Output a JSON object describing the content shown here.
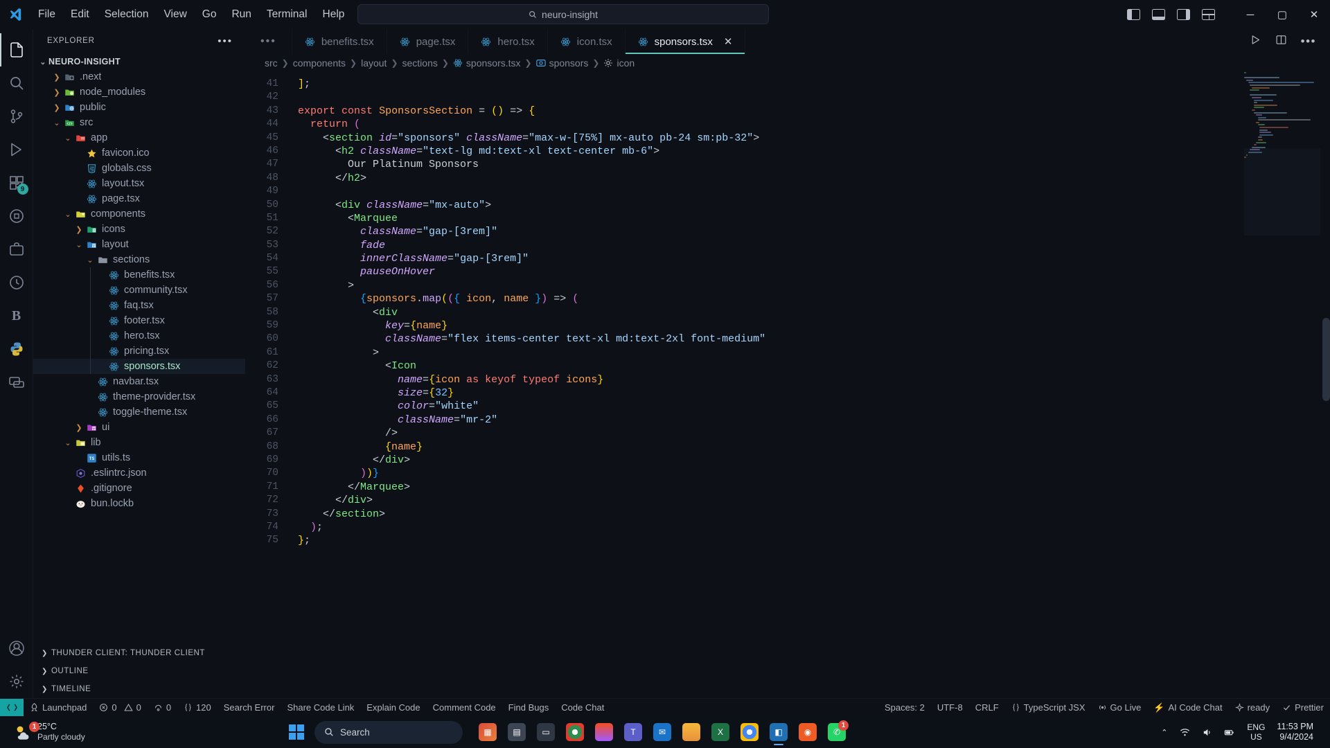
{
  "titlebar": {
    "menus": [
      "File",
      "Edit",
      "Selection",
      "View",
      "Go",
      "Run",
      "Terminal",
      "Help"
    ],
    "search_value": "neuro-insight",
    "back_arrow": "←",
    "forward_arrow": "→",
    "minimize": "─",
    "maximize": "▢",
    "close": "✕"
  },
  "activitybar": {
    "items": [
      {
        "name": "explorer",
        "badge": ""
      },
      {
        "name": "search",
        "badge": ""
      },
      {
        "name": "source-control",
        "badge": ""
      },
      {
        "name": "run-and-debug",
        "badge": ""
      },
      {
        "name": "extensions",
        "badge": "9"
      },
      {
        "name": "testing",
        "badge": ""
      },
      {
        "name": "remote-explorer",
        "badge": ""
      },
      {
        "name": "error-lens",
        "badge": ""
      },
      {
        "name": "better-comments",
        "badge": "B"
      },
      {
        "name": "python",
        "badge": ""
      },
      {
        "name": "live-share",
        "badge": ""
      },
      {
        "name": "accounts",
        "badge": ""
      },
      {
        "name": "manage-settings",
        "badge": ""
      }
    ],
    "letter_b": "B"
  },
  "sidebar": {
    "title": "EXPLORER",
    "more_actions": "•••",
    "root": "NEURO-INSIGHT",
    "tree": [
      {
        "label": ".next",
        "depth": 1,
        "type": "folder",
        "state": "collapsed",
        "icon": "folder-next"
      },
      {
        "label": "node_modules",
        "depth": 1,
        "type": "folder",
        "state": "collapsed",
        "icon": "folder-node"
      },
      {
        "label": "public",
        "depth": 1,
        "type": "folder",
        "state": "collapsed",
        "icon": "folder-public"
      },
      {
        "label": "src",
        "depth": 1,
        "type": "folder",
        "state": "expanded",
        "icon": "folder-src"
      },
      {
        "label": "app",
        "depth": 2,
        "type": "folder",
        "state": "expanded",
        "icon": "folder-app"
      },
      {
        "label": "favicon.ico",
        "depth": 3,
        "type": "file",
        "icon": "star-icon"
      },
      {
        "label": "globals.css",
        "depth": 3,
        "type": "file",
        "icon": "css-icon"
      },
      {
        "label": "layout.tsx",
        "depth": 3,
        "type": "file",
        "icon": "react-icon"
      },
      {
        "label": "page.tsx",
        "depth": 3,
        "type": "file",
        "icon": "react-icon"
      },
      {
        "label": "components",
        "depth": 2,
        "type": "folder",
        "state": "expanded",
        "icon": "folder-components"
      },
      {
        "label": "icons",
        "depth": 3,
        "type": "folder",
        "state": "collapsed",
        "icon": "folder-icons"
      },
      {
        "label": "layout",
        "depth": 3,
        "type": "folder",
        "state": "expanded",
        "icon": "folder-layout"
      },
      {
        "label": "sections",
        "depth": 4,
        "type": "folder",
        "state": "expanded",
        "icon": "folder-plain"
      },
      {
        "label": "benefits.tsx",
        "depth": 5,
        "type": "file",
        "icon": "react-icon"
      },
      {
        "label": "community.tsx",
        "depth": 5,
        "type": "file",
        "icon": "react-icon"
      },
      {
        "label": "faq.tsx",
        "depth": 5,
        "type": "file",
        "icon": "react-icon"
      },
      {
        "label": "footer.tsx",
        "depth": 5,
        "type": "file",
        "icon": "react-icon"
      },
      {
        "label": "hero.tsx",
        "depth": 5,
        "type": "file",
        "icon": "react-icon"
      },
      {
        "label": "pricing.tsx",
        "depth": 5,
        "type": "file",
        "icon": "react-icon"
      },
      {
        "label": "sponsors.tsx",
        "depth": 5,
        "type": "file",
        "icon": "react-icon",
        "selected": true
      },
      {
        "label": "navbar.tsx",
        "depth": 4,
        "type": "file",
        "icon": "react-icon"
      },
      {
        "label": "theme-provider.tsx",
        "depth": 4,
        "type": "file",
        "icon": "react-icon"
      },
      {
        "label": "toggle-theme.tsx",
        "depth": 4,
        "type": "file",
        "icon": "react-icon"
      },
      {
        "label": "ui",
        "depth": 3,
        "type": "folder",
        "state": "collapsed",
        "icon": "folder-ui"
      },
      {
        "label": "lib",
        "depth": 2,
        "type": "folder",
        "state": "expanded",
        "icon": "folder-lib"
      },
      {
        "label": "utils.ts",
        "depth": 3,
        "type": "file",
        "icon": "ts-icon"
      },
      {
        "label": ".eslintrc.json",
        "depth": 2,
        "type": "file",
        "icon": "eslint-icon"
      },
      {
        "label": ".gitignore",
        "depth": 2,
        "type": "file",
        "icon": "git-icon"
      },
      {
        "label": "bun.lockb",
        "depth": 2,
        "type": "file",
        "icon": "bun-icon"
      }
    ],
    "sections": [
      "THUNDER CLIENT: THUNDER CLIENT",
      "OUTLINE",
      "TIMELINE"
    ]
  },
  "tabs": [
    {
      "label": "benefits.tsx",
      "active": false,
      "icon": "react-icon"
    },
    {
      "label": "page.tsx",
      "active": false,
      "icon": "react-icon"
    },
    {
      "label": "hero.tsx",
      "active": false,
      "icon": "react-icon"
    },
    {
      "label": "icon.tsx",
      "active": false,
      "icon": "react-icon"
    },
    {
      "label": "sponsors.tsx",
      "active": true,
      "icon": "react-icon",
      "close": "✕"
    }
  ],
  "tab_overflow": "•••",
  "breadcrumb": [
    {
      "label": "src",
      "icon": ""
    },
    {
      "label": "components",
      "icon": ""
    },
    {
      "label": "layout",
      "icon": ""
    },
    {
      "label": "sections",
      "icon": ""
    },
    {
      "label": "sponsors.tsx",
      "icon": "react-icon"
    },
    {
      "label": "sponsors",
      "icon": "symbol-variable"
    },
    {
      "label": "icon",
      "icon": "symbol-property"
    }
  ],
  "editor": {
    "first_line": 41,
    "last_line": 75,
    "lines": [
      {
        "n": 41,
        "html": "<span class='br1'>]</span><span class='pun'>;</span>"
      },
      {
        "n": 42,
        "html": ""
      },
      {
        "n": 43,
        "html": "<span class='kw'>export</span> <span class='kw'>const</span> <span class='var'>SponsorsSection</span> <span class='pun'>=</span> <span class='br1'>(</span><span class='br1'>)</span> <span class='pun'>=&gt;</span> <span class='br1'>{</span>"
      },
      {
        "n": 44,
        "html": "  <span class='kw'>return</span> <span class='br2'>(</span>"
      },
      {
        "n": 45,
        "html": "    <span class='pun'>&lt;</span><span class='tag'>section</span> <span class='attr'>id</span><span class='pun'>=</span><span class='str'>\"sponsors\"</span> <span class='attr'>className</span><span class='pun'>=</span><span class='str'>\"max-w-[75%] mx-auto pb-24 sm:pb-32\"</span><span class='pun'>&gt;</span>"
      },
      {
        "n": 46,
        "html": "      <span class='pun'>&lt;</span><span class='tag'>h2</span> <span class='attr'>className</span><span class='pun'>=</span><span class='str'>\"text-lg md:text-xl text-center mb-6\"</span><span class='pun'>&gt;</span>"
      },
      {
        "n": 47,
        "html": "        <span class='pun'>Our Platinum Sponsors</span>"
      },
      {
        "n": 48,
        "html": "      <span class='pun'>&lt;/</span><span class='tag'>h2</span><span class='pun'>&gt;</span>"
      },
      {
        "n": 49,
        "html": ""
      },
      {
        "n": 50,
        "html": "      <span class='pun'>&lt;</span><span class='tag'>div</span> <span class='attr'>className</span><span class='pun'>=</span><span class='str'>\"mx-auto\"</span><span class='pun'>&gt;</span>"
      },
      {
        "n": 51,
        "html": "        <span class='pun'>&lt;</span><span class='tag'>Marquee</span>"
      },
      {
        "n": 52,
        "html": "          <span class='attr'>className</span><span class='pun'>=</span><span class='str'>\"gap-[3rem]\"</span>"
      },
      {
        "n": 53,
        "html": "          <span class='attr'>fade</span>"
      },
      {
        "n": 54,
        "html": "          <span class='attr'>innerClassName</span><span class='pun'>=</span><span class='str'>\"gap-[3rem]\"</span>"
      },
      {
        "n": 55,
        "html": "          <span class='attr'>pauseOnHover</span>"
      },
      {
        "n": 56,
        "html": "        <span class='pun'>&gt;</span>"
      },
      {
        "n": 57,
        "html": "          <span class='br3'>{</span><span class='var'>sponsors</span><span class='pun'>.</span><span class='fn'>map</span><span class='br1'>(</span><span class='br2'>(</span><span class='br3'>{</span> <span class='var'>icon</span><span class='pun'>,</span> <span class='var'>name</span> <span class='br3'>}</span><span class='br2'>)</span> <span class='pun'>=&gt;</span> <span class='br2'>(</span>"
      },
      {
        "n": 58,
        "html": "            <span class='pun'>&lt;</span><span class='tag'>div</span>"
      },
      {
        "n": 59,
        "html": "              <span class='attr'>key</span><span class='pun'>=</span><span class='br1'>{</span><span class='var'>name</span><span class='br1'>}</span>"
      },
      {
        "n": 60,
        "html": "              <span class='attr'>className</span><span class='pun'>=</span><span class='str'>\"flex items-center text-xl md:text-2xl font-medium\"</span>"
      },
      {
        "n": 61,
        "html": "            <span class='pun'>&gt;</span>"
      },
      {
        "n": 62,
        "html": "              <span class='pun'>&lt;</span><span class='tag'>Icon</span>"
      },
      {
        "n": 63,
        "html": "                <span class='attr'>name</span><span class='pun'>=</span><span class='br1'>{</span><span class='var'>icon</span> <span class='kw'>as</span> <span class='kw'>keyof</span> <span class='kw'>typeof</span> <span class='var'>icons</span><span class='br1'>}</span>"
      },
      {
        "n": 64,
        "html": "                <span class='attr'>size</span><span class='pun'>=</span><span class='br1'>{</span><span class='num'>32</span><span class='br1'>}</span>"
      },
      {
        "n": 65,
        "html": "                <span class='attr'>color</span><span class='pun'>=</span><span class='str'>\"white\"</span>"
      },
      {
        "n": 66,
        "html": "                <span class='attr'>className</span><span class='pun'>=</span><span class='str'>\"mr-2\"</span>"
      },
      {
        "n": 67,
        "html": "              <span class='pun'>/&gt;</span>"
      },
      {
        "n": 68,
        "html": "              <span class='br1'>{</span><span class='var'>name</span><span class='br1'>}</span>"
      },
      {
        "n": 69,
        "html": "            <span class='pun'>&lt;/</span><span class='tag'>div</span><span class='pun'>&gt;</span>"
      },
      {
        "n": 70,
        "html": "          <span class='br2'>)</span><span class='br1'>)</span><span class='br3'>}</span>"
      },
      {
        "n": 71,
        "html": "        <span class='pun'>&lt;/</span><span class='tag'>Marquee</span><span class='pun'>&gt;</span>"
      },
      {
        "n": 72,
        "html": "      <span class='pun'>&lt;/</span><span class='tag'>div</span><span class='pun'>&gt;</span>"
      },
      {
        "n": 73,
        "html": "    <span class='pun'>&lt;/</span><span class='tag'>section</span><span class='pun'>&gt;</span>"
      },
      {
        "n": 74,
        "html": "  <span class='br2'>)</span><span class='pun'>;</span>"
      },
      {
        "n": 75,
        "html": "<span class='br1'>}</span><span class='pun'>;</span>"
      }
    ]
  },
  "statusbar": {
    "left": [
      {
        "label": "Launchpad",
        "icon": "rocket-icon"
      },
      {
        "label": "0",
        "icon": "error-icon",
        "label2": "0",
        "icon2": "warning-icon"
      },
      {
        "label": "0",
        "icon": "ports-icon"
      },
      {
        "label": "120",
        "icon": "braces-icon"
      },
      {
        "label": "Search Error"
      },
      {
        "label": "Share Code Link"
      },
      {
        "label": "Explain Code"
      },
      {
        "label": "Comment Code"
      },
      {
        "label": "Find Bugs"
      },
      {
        "label": "Code Chat"
      }
    ],
    "right": [
      {
        "label": "Spaces: 2"
      },
      {
        "label": "UTF-8"
      },
      {
        "label": "CRLF"
      },
      {
        "label": "TypeScript JSX",
        "icon": "braces-icon"
      },
      {
        "label": "Go Live",
        "icon": "broadcast-icon"
      },
      {
        "label": "AI Code Chat",
        "icon": "bolt-icon"
      },
      {
        "label": "ready",
        "icon": "sparkle-icon"
      },
      {
        "label": "Prettier",
        "icon": "check-icon"
      }
    ],
    "errors_count": "0",
    "warnings_count": "0",
    "ports_count": "0",
    "tabnine_count": "120"
  },
  "taskbar": {
    "weather": {
      "temp": "25°C",
      "condition": "Partly cloudy",
      "badge": "1"
    },
    "search_placeholder": "Search",
    "apps": [
      {
        "name": "task-view"
      },
      {
        "name": "widgets-news"
      },
      {
        "name": "file-explorer-window"
      },
      {
        "name": "chrome-browser"
      },
      {
        "name": "figma"
      },
      {
        "name": "microsoft-teams"
      },
      {
        "name": "outlook-mail"
      },
      {
        "name": "file-explorer"
      },
      {
        "name": "excel"
      },
      {
        "name": "chrome-2"
      },
      {
        "name": "vs-code",
        "running": true
      },
      {
        "name": "postman"
      },
      {
        "name": "whatsapp",
        "badge": "1"
      }
    ],
    "tray_chevron": "⌃",
    "language": {
      "line1": "ENG",
      "line2": "US"
    },
    "clock": {
      "time": "11:53 PM",
      "date": "9/4/2024"
    }
  }
}
